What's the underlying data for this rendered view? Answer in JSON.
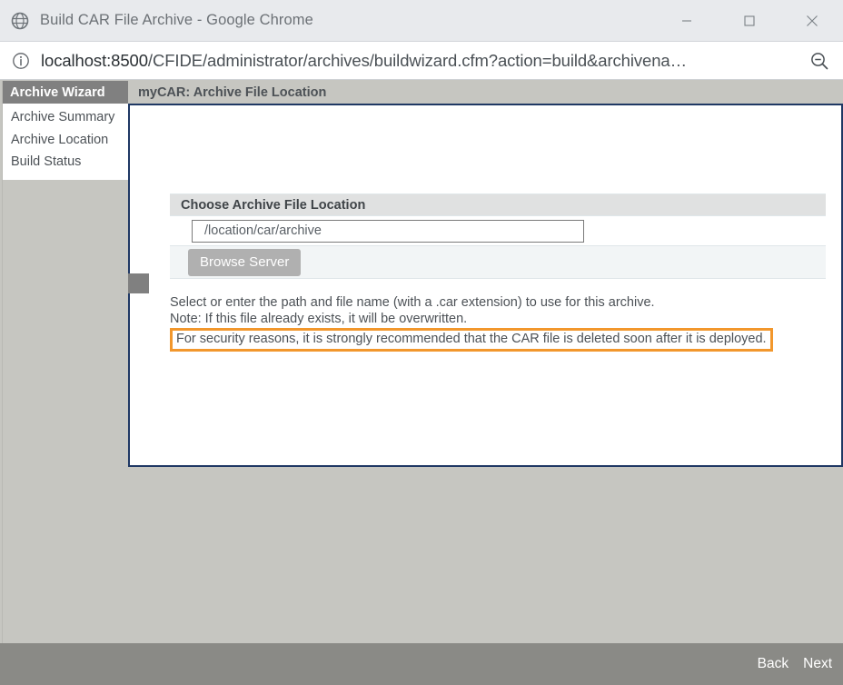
{
  "window": {
    "title": "Build CAR File Archive - Google Chrome",
    "favicon": "globe-icon",
    "minimize_label": "—",
    "maximize_label": "□",
    "close_label": "✕"
  },
  "omnibox": {
    "security_icon": "info-circle-icon",
    "url_host": "localhost:8500",
    "url_path": "/CFIDE/administrator/archives/buildwizard.cfm?action=build&archivena…",
    "zoom_icon": "zoom-out-icon"
  },
  "sidebar": {
    "header": "Archive Wizard",
    "items": [
      {
        "label": "Archive Summary"
      },
      {
        "label": "Archive Location"
      },
      {
        "label": "Build Status"
      }
    ]
  },
  "panel": {
    "header": "myCAR: Archive File Location",
    "section_title": "Choose Archive File Location",
    "path_value": "/location/car/archive",
    "path_placeholder": "/location/car/archive",
    "browse_label": "Browse Server",
    "help_lines": [
      "Select or enter the path and file name (with a .car extension) to use for this archive.",
      "Note: If this file already exists, it will be overwritten."
    ],
    "security_notice": "For security reasons, it is strongly recommended that the CAR file is deleted soon after it is deployed."
  },
  "footer": {
    "back_label": "Back",
    "next_label": "Next"
  },
  "colors": {
    "highlight_border": "#f2972c",
    "sidebar_header_bg": "#808080",
    "panel_border": "#1f3864",
    "footer_bg": "#8a8a86",
    "page_bg": "#c6c6c1",
    "button_bg": "#b0b0b0"
  }
}
